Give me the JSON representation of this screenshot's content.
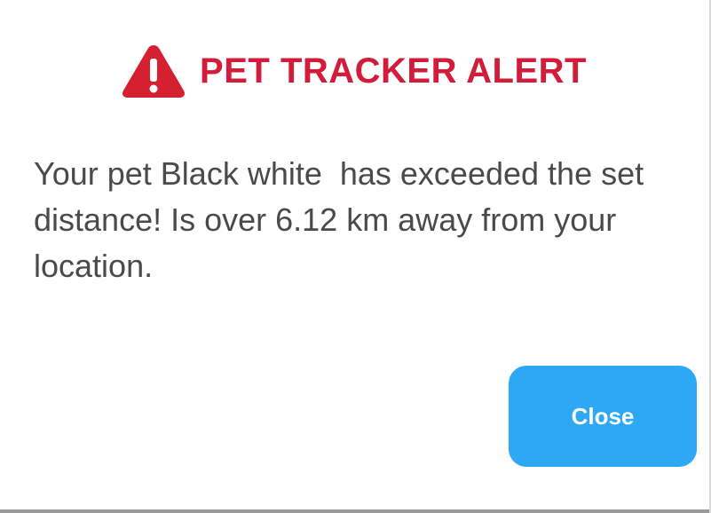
{
  "dialog": {
    "title": "PET TRACKER ALERT",
    "title_icon": "warning-triangle-icon",
    "message": "Your pet Black white  has exceeded the set distance! Is over 6.12 km away from your location.",
    "close_label": "Close"
  },
  "colors": {
    "title": "#d31b3a",
    "icon": "#d42030",
    "message_text": "#4a4a4a",
    "button_background": "#2ea7f5",
    "button_text": "#ffffff",
    "background": "#ffffff"
  }
}
